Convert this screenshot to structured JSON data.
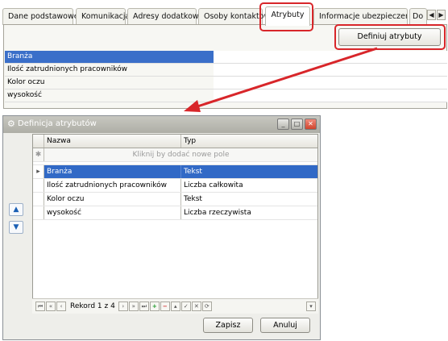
{
  "tabs": [
    "Dane podstawowe",
    "Komunikacja",
    "Adresy dodatkowe",
    "Osoby kontaktowe",
    "Atrybuty",
    "Informacje ubezpieczeniowe",
    "Do"
  ],
  "active_tab": "Atrybuty",
  "define_button": "Definiuj atrybuty",
  "attributes": [
    "Branża",
    "Ilość zatrudnionych pracowników",
    "Kolor oczu",
    "wysokość"
  ],
  "dialog": {
    "title": "Definicja atrybutów",
    "columns": [
      "Nazwa",
      "Typ"
    ],
    "new_row_hint": "Kliknij by dodać nowe pole",
    "rows": [
      {
        "name": "Branża",
        "type": "Tekst"
      },
      {
        "name": "Ilość zatrudnionych pracowników",
        "type": "Liczba całkowita"
      },
      {
        "name": "Kolor oczu",
        "type": "Tekst"
      },
      {
        "name": "wysokość",
        "type": "Liczba rzeczywista"
      }
    ],
    "record_label": "Rekord 1 z 4",
    "save": "Zapisz",
    "cancel": "Anuluj"
  },
  "colors": {
    "highlight": "#d8262a",
    "selection": "#3169c6",
    "accent_row": "#3a6fc9"
  }
}
